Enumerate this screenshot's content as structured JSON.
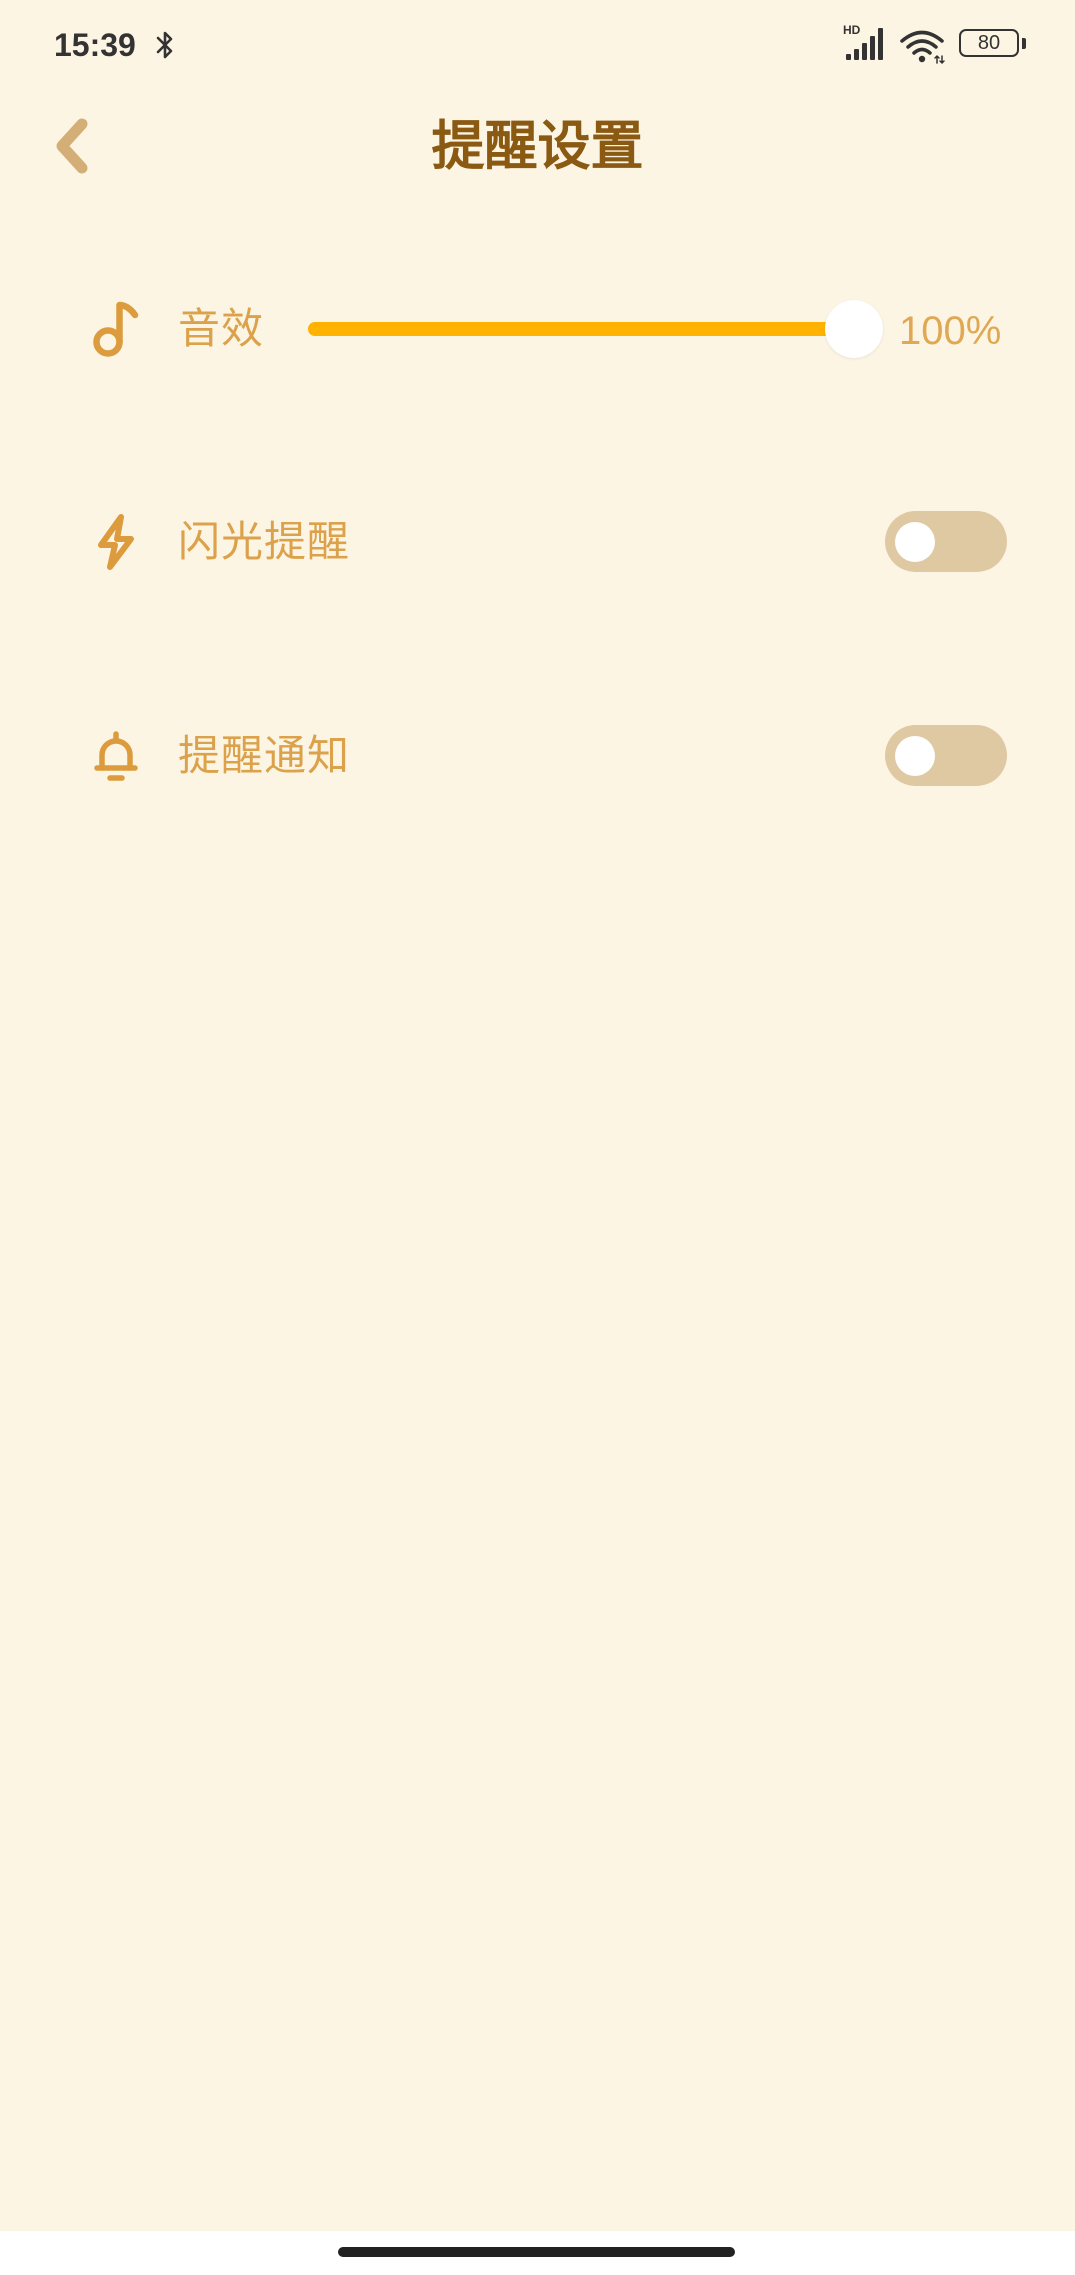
{
  "status_bar": {
    "time": "15:39",
    "network_badge": "HD",
    "battery_level": "80",
    "icons": [
      "bluetooth-icon",
      "signal-icon",
      "wifi-icon",
      "battery-icon"
    ]
  },
  "header": {
    "back_icon": "chevron-left-icon",
    "title": "提醒设置"
  },
  "settings": {
    "sound": {
      "icon": "music-note-icon",
      "label": "音效",
      "volume": 100,
      "volume_text": "100%"
    },
    "flash_reminder": {
      "icon": "lightning-icon",
      "label": "闪光提醒",
      "on": false
    },
    "notification_reminder": {
      "icon": "bell-icon",
      "label": "提醒通知",
      "on": false
    }
  },
  "colors": {
    "background": "#fdf5e4",
    "title": "#8a5912",
    "label": "#dba24b",
    "value_text": "#e0a853",
    "icon": "#dc9b3d",
    "accent": "#ffb300",
    "toggle_off": "#dfc9a3",
    "knob": "#ffffff",
    "back_icon": "#d3af77",
    "status_icons": "#333333",
    "nav_bar": "#ffffff",
    "home_indicator": "#222222"
  }
}
